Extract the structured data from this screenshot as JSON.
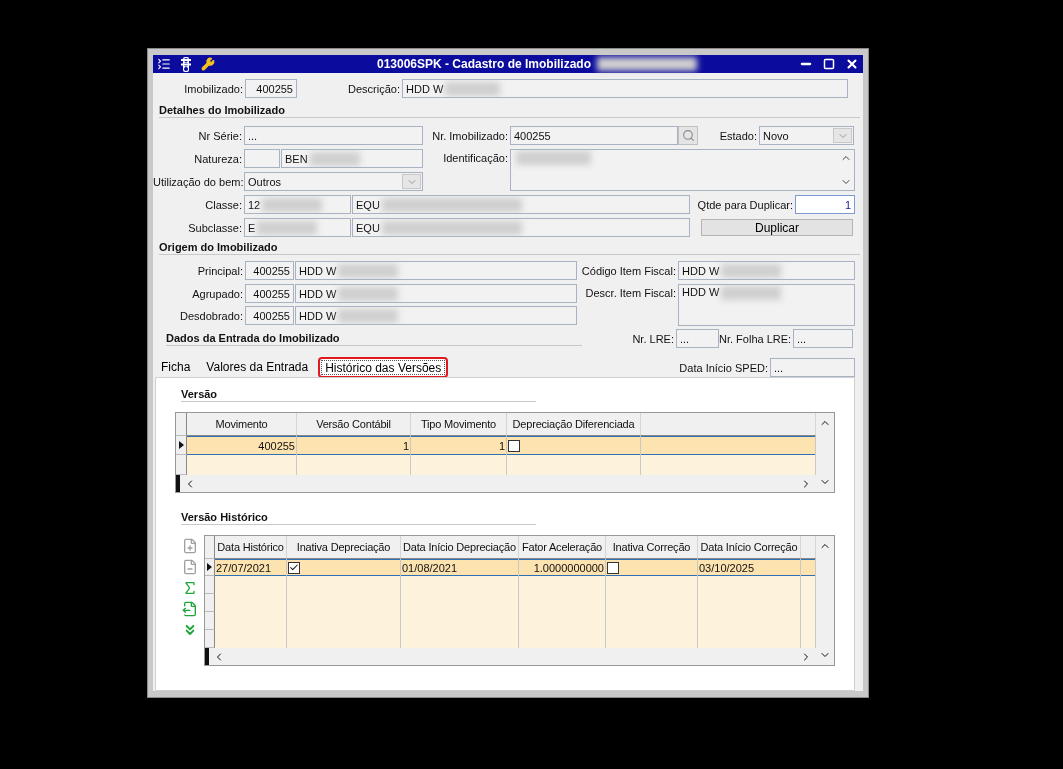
{
  "window": {
    "title": "013006SPK - Cadastro de Imobilizado",
    "title_redacted": true
  },
  "top": {
    "imobilizado": {
      "label": "Imobilizado:",
      "value": "400255"
    },
    "descricao": {
      "label": "Descrição:",
      "value": "HDD W",
      "redacted": true
    }
  },
  "detalhes": {
    "title": "Detalhes do Imobilizado",
    "nr_serie": {
      "label": "Nr Série:",
      "value": "..."
    },
    "nr_imobilizado": {
      "label": "Nr. Imobilizado:",
      "value": "400255"
    },
    "estado": {
      "label": "Estado:",
      "value": "Novo"
    },
    "natureza": {
      "label": "Natureza:",
      "value": "BEN",
      "redacted": true
    },
    "identificacao": {
      "label": "Identificação:",
      "redacted": true
    },
    "utilizacao": {
      "label": "Utilização do bem:",
      "value": "Outros"
    },
    "classe": {
      "label": "Classe:",
      "code": "12",
      "value": "EQU",
      "redacted": true
    },
    "subclasse": {
      "label": "Subclasse:",
      "code": "E",
      "value": "EQU",
      "redacted": true
    },
    "qtde": {
      "label": "Qtde para Duplicar:",
      "value": "1"
    },
    "duplicar": "Duplicar"
  },
  "origem": {
    "title": "Origem do Imobilizado",
    "rows": [
      {
        "label": "Principal:",
        "code": "400255",
        "value": "HDD W",
        "redacted": true
      },
      {
        "label": "Agrupado:",
        "code": "400255",
        "value": "HDD W",
        "redacted": true
      },
      {
        "label": "Desdobrado:",
        "code": "400255",
        "value": "HDD W",
        "redacted": true
      }
    ],
    "codigo_item_fiscal": {
      "label": "Código Item Fiscal:",
      "value": "HDD W",
      "redacted": true
    },
    "descr_item_fiscal": {
      "label": "Descr. Item Fiscal:",
      "value": "HDD W",
      "redacted": true
    }
  },
  "entrada": {
    "title": "Dados da Entrada do Imobilizado",
    "nr_lre": {
      "label": "Nr. LRE:",
      "value": "..."
    },
    "nr_folha_lre": {
      "label": "Nr. Folha LRE:",
      "value": "..."
    },
    "data_inicio_sped": {
      "label": "Data Início SPED:",
      "value": "..."
    }
  },
  "tabs": [
    {
      "label": "Ficha",
      "selected": false
    },
    {
      "label": "Valores da Entrada",
      "selected": false
    },
    {
      "label": "Histórico das Versões",
      "selected": true
    }
  ],
  "versao": {
    "title": "Versão",
    "columns": [
      {
        "label": "Movimento",
        "kind": "number"
      },
      {
        "label": "Versão Contábil",
        "kind": "number"
      },
      {
        "label": "Tipo Movimento",
        "kind": "number"
      },
      {
        "label": "Depreciação Diferenciada",
        "kind": "check"
      }
    ],
    "rows": [
      {
        "selected": true,
        "cells": [
          "400255",
          "1",
          "1",
          false
        ]
      }
    ]
  },
  "historico": {
    "title": "Versão Histórico",
    "columns": [
      {
        "label": "Data Histórico",
        "kind": "text"
      },
      {
        "label": "Inativa Depreciação",
        "kind": "check"
      },
      {
        "label": "Data Início Depreciação",
        "kind": "text"
      },
      {
        "label": "Fator Aceleração",
        "kind": "number"
      },
      {
        "label": "Inativa Correção",
        "kind": "check"
      },
      {
        "label": "Data Início Correção",
        "kind": "text"
      }
    ],
    "rows": [
      {
        "selected": true,
        "cells": [
          "27/07/2021",
          true,
          "01/08/2021",
          "1.0000000000",
          false,
          "03/10/2025"
        ]
      }
    ]
  }
}
